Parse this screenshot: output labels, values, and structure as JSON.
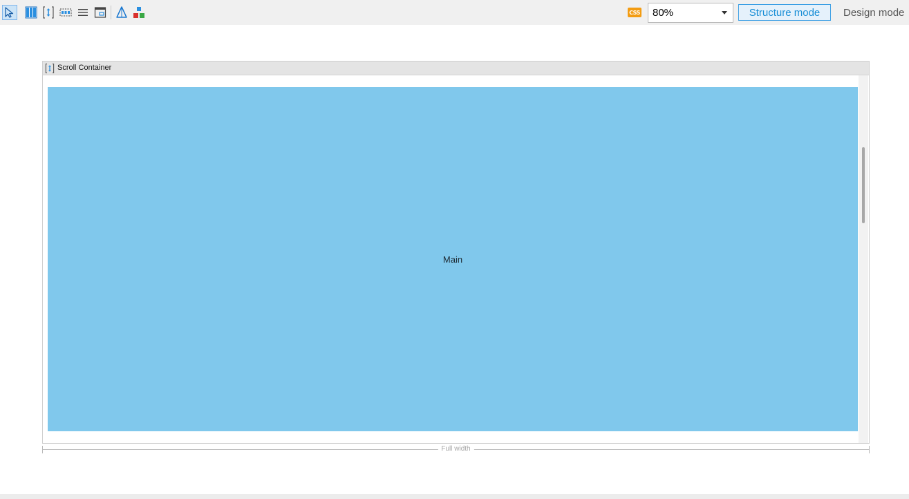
{
  "toolbar": {
    "tools": [
      {
        "icon": "pointer-icon",
        "active": true
      },
      {
        "icon": "columns-icon",
        "active": false
      },
      {
        "icon": "scroll-container-icon",
        "active": false
      },
      {
        "icon": "dashed-grid-icon",
        "active": false
      },
      {
        "icon": "list-lines-icon",
        "active": false
      },
      {
        "icon": "window-frame-icon",
        "active": false
      },
      {
        "icon": "triangle-icon",
        "active": false
      },
      {
        "icon": "component-blocks-icon",
        "active": false
      }
    ],
    "css_badge": "CSS",
    "zoom": {
      "value": "80%"
    },
    "structure_mode_label": "Structure mode",
    "design_mode_label": "Design mode"
  },
  "canvas": {
    "scroll_container": {
      "title": "Scroll Container",
      "main_label": "Main"
    },
    "width_indicator_label": "Full width"
  },
  "colors": {
    "main_fill": "#80c8ec",
    "accent": "#1a8fd6",
    "css_badge": "#f39c12"
  }
}
